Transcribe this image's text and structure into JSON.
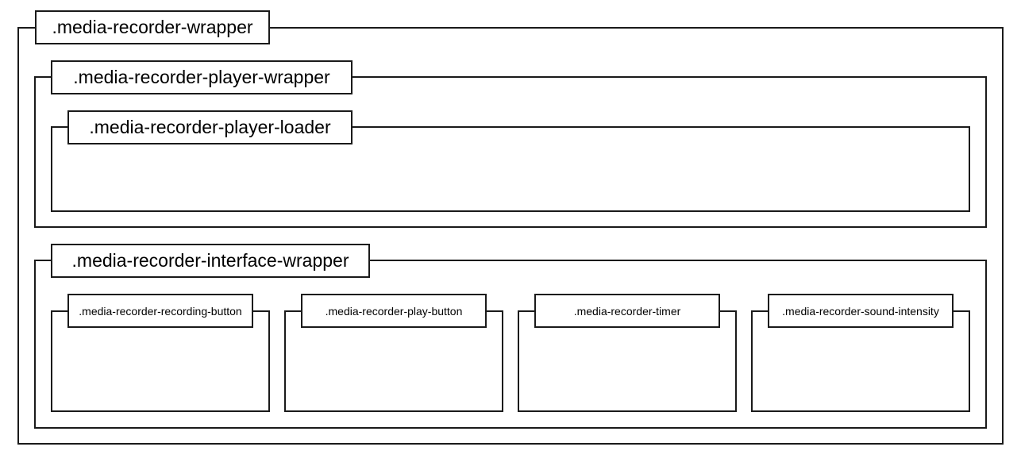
{
  "diagram": {
    "root": {
      "label": ".media-recorder-wrapper"
    },
    "player_wrapper": {
      "label": ".media-recorder-player-wrapper"
    },
    "player_loader": {
      "label": ".media-recorder-player-loader"
    },
    "interface_wrapper": {
      "label": ".media-recorder-interface-wrapper"
    },
    "interface_items": [
      {
        "label": ".media-recorder-recording-button"
      },
      {
        "label": ".media-recorder-play-button"
      },
      {
        "label": ".media-recorder-timer"
      },
      {
        "label": ".media-recorder-sound-intensity"
      }
    ]
  },
  "colors": {
    "border": "#1a1a1a",
    "background": "#ffffff",
    "text": "#000000"
  }
}
